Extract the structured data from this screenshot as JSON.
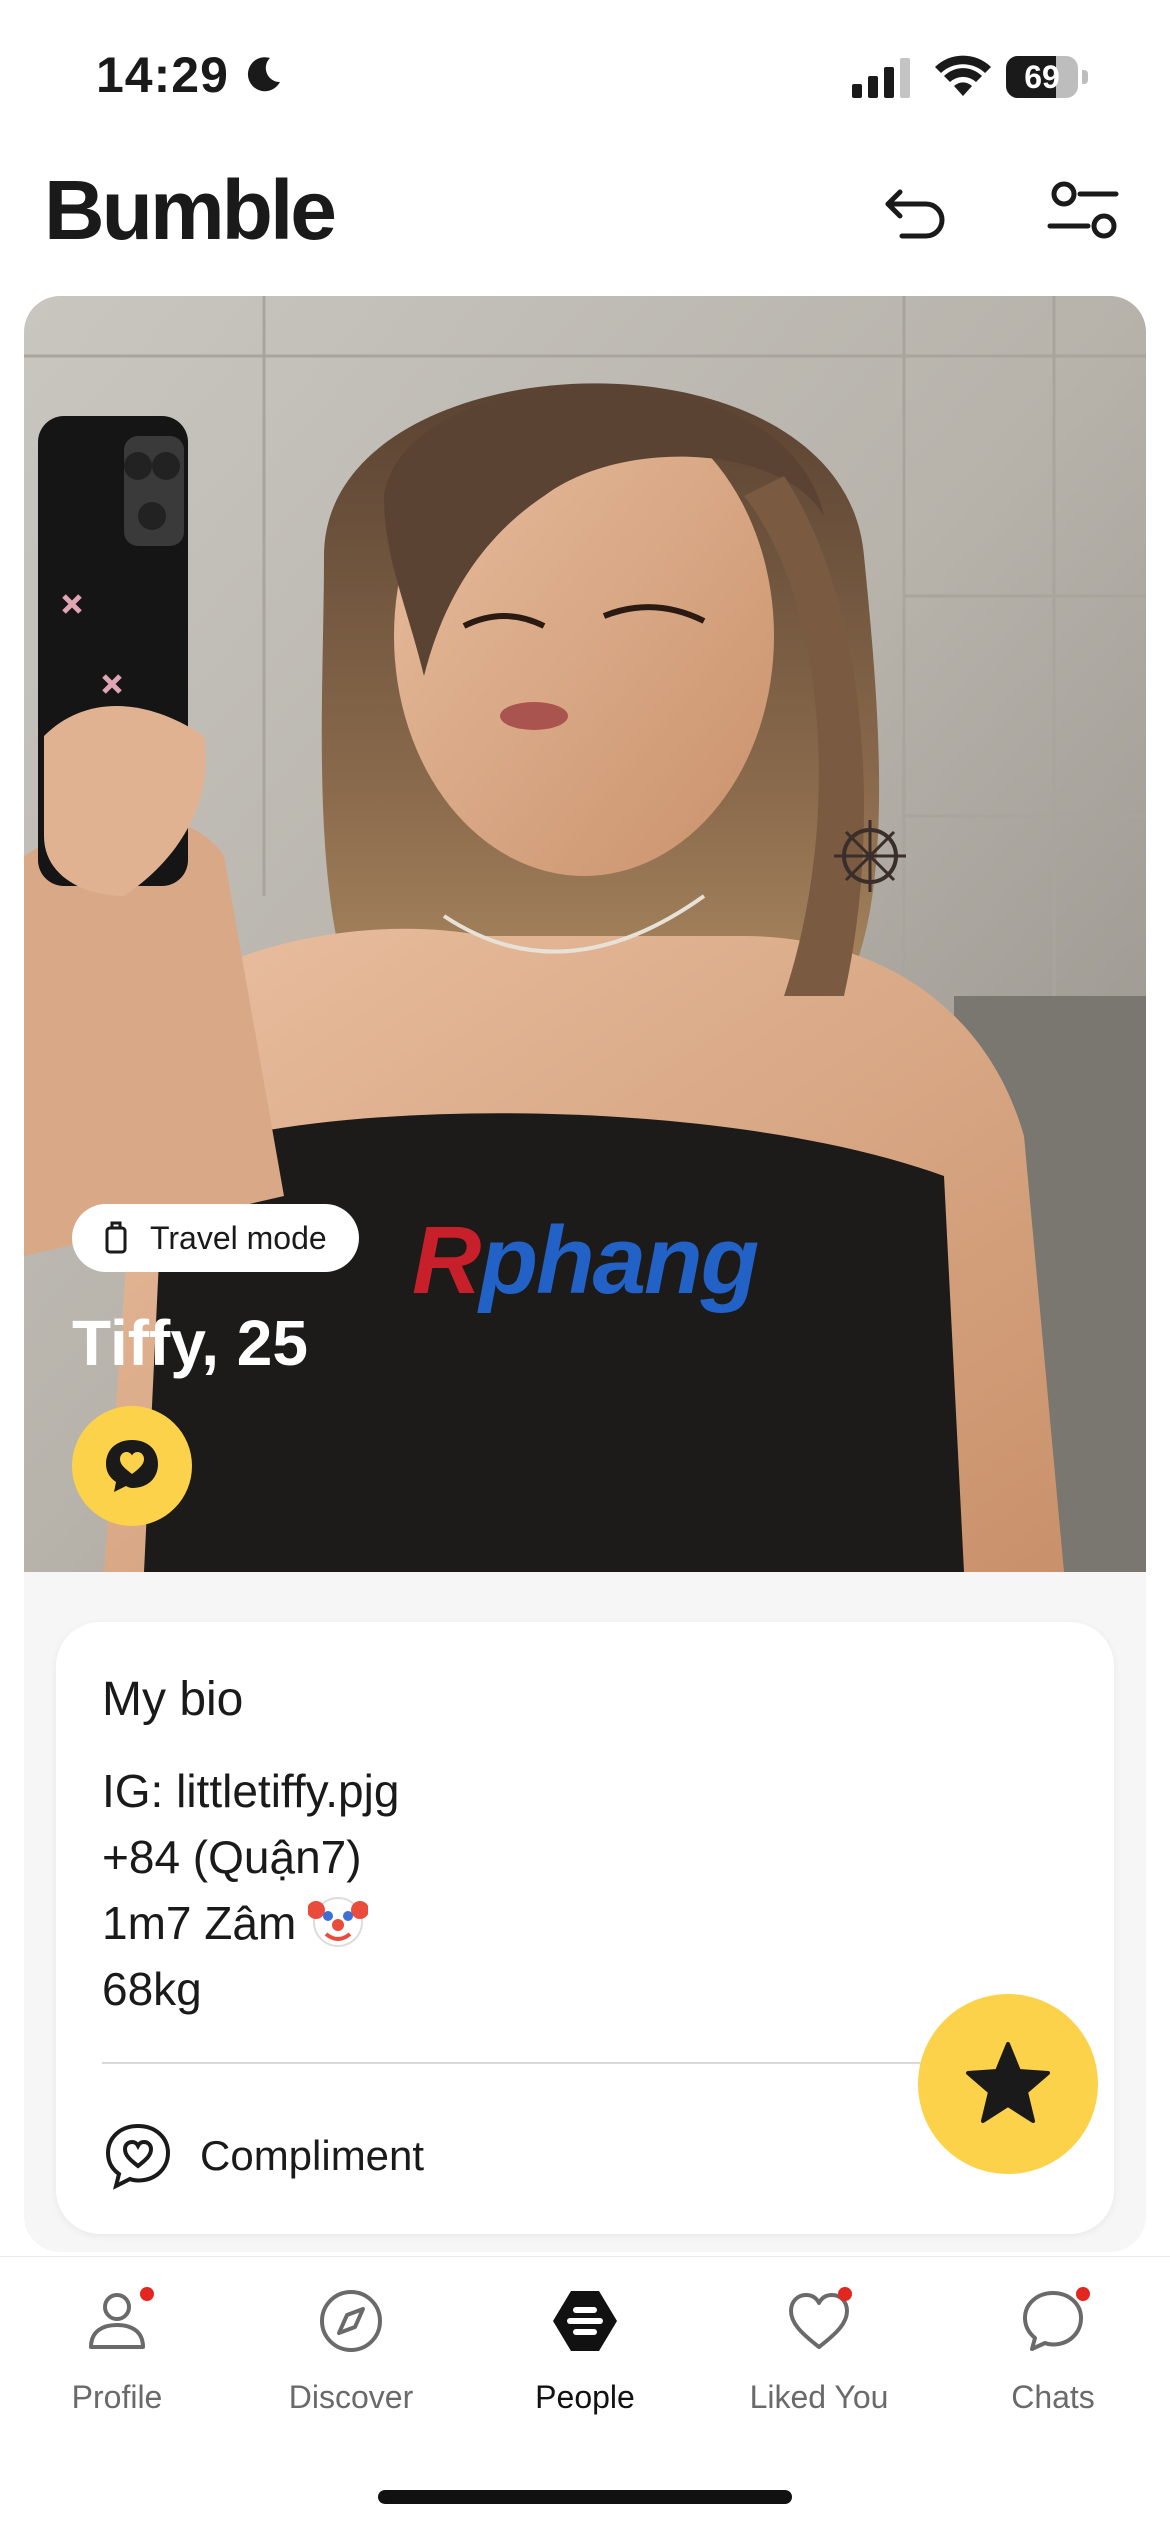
{
  "status_bar": {
    "time": "14:29",
    "battery": "69",
    "battery_percent": 69
  },
  "header": {
    "logo": "Bumble",
    "undo_icon": "undo-icon",
    "filter_icon": "filter-icon"
  },
  "profile": {
    "travel_mode_label": "Travel mode",
    "name_age": "Tiffy, 25",
    "watermark_first": "R",
    "watermark_rest": "phang"
  },
  "bio": {
    "title": "My bio",
    "lines": [
      "IG: littletiffy.pjg",
      "+84 (Quận7)",
      "1m7 Zâm",
      "68kg"
    ],
    "emoji": "clown-face-emoji",
    "compliment_label": "Compliment"
  },
  "tabs": [
    {
      "label": "Profile",
      "icon": "profile-icon",
      "badge": true
    },
    {
      "label": "Discover",
      "icon": "compass-icon",
      "badge": false
    },
    {
      "label": "People",
      "icon": "bumble-hive-icon",
      "badge": false,
      "active": true
    },
    {
      "label": "Liked You",
      "icon": "heart-icon",
      "badge": true
    },
    {
      "label": "Chats",
      "icon": "chat-bubble-icon",
      "badge": true
    }
  ],
  "colors": {
    "accent_yellow": "#fbd24a",
    "badge_red": "#e3261f",
    "text_dark": "#1a1a1a"
  }
}
